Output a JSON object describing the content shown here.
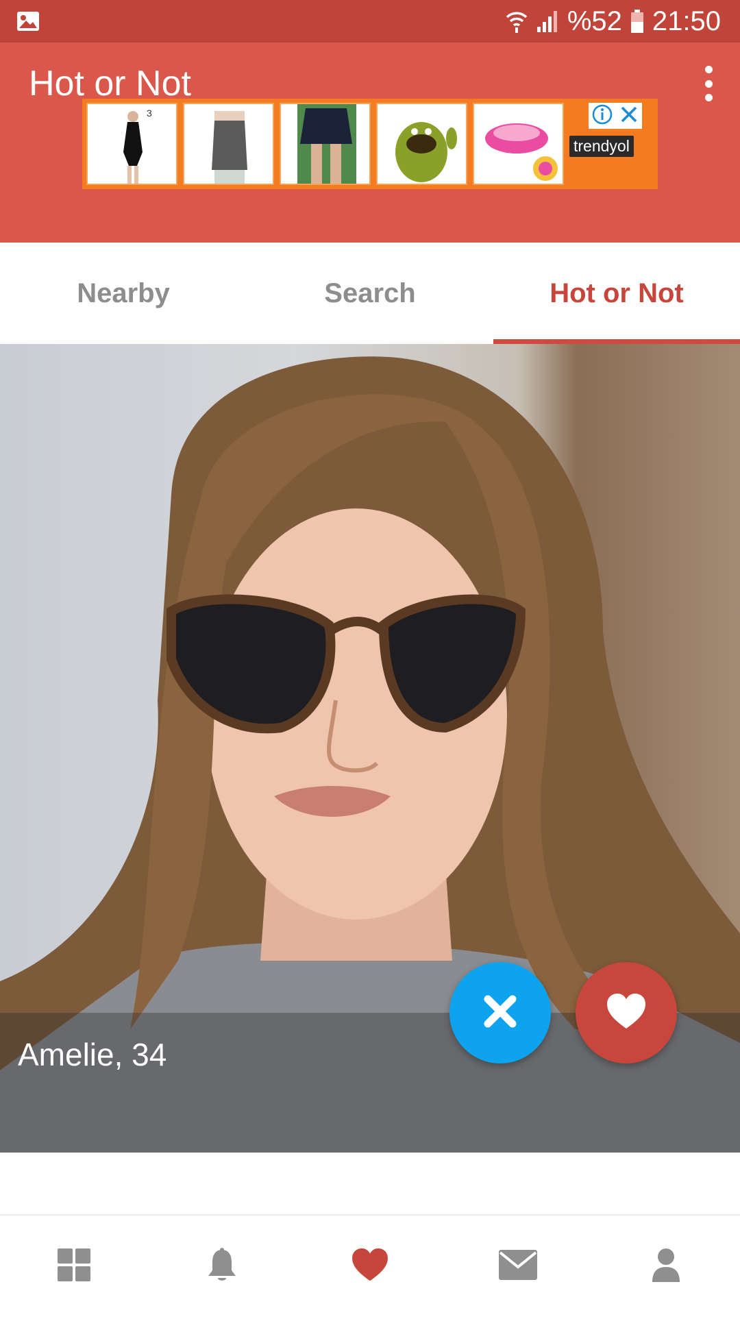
{
  "status_bar": {
    "battery": "%52",
    "time": "21:50"
  },
  "app_bar": {
    "title": "Hot or Not"
  },
  "ad": {
    "brand": "trendyol",
    "thumbnail_badge": "3"
  },
  "tabs": [
    {
      "label": "Nearby",
      "active": false
    },
    {
      "label": "Search",
      "active": false
    },
    {
      "label": "Hot or Not",
      "active": true
    }
  ],
  "profile": {
    "name_age": "Amelie, 34"
  },
  "bottom_nav": [
    "grid-icon",
    "bell-icon",
    "heart-icon",
    "mail-icon",
    "person-icon"
  ],
  "colors": {
    "status_bar": "#c0443a",
    "app_bar": "#d9584b",
    "accent": "#c7463b",
    "dislike": "#0da3ee",
    "like": "#c7473c",
    "inactive": "#8d8d8d"
  }
}
